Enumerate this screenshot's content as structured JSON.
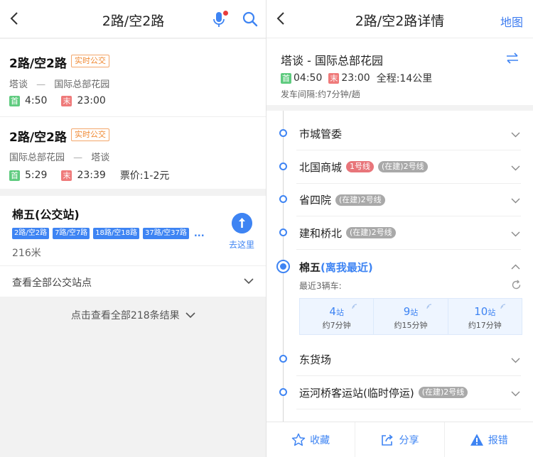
{
  "left": {
    "header": {
      "title": "2路/空2路"
    },
    "results": [
      {
        "name": "2路/空2路",
        "badge": "实时公交",
        "from": "塔谈",
        "dash": "—",
        "to": "国际总部花园",
        "first_tag": "首",
        "first_time": "4:50",
        "last_tag": "末",
        "last_time": "23:00",
        "fare": ""
      },
      {
        "name": "2路/空2路",
        "badge": "实时公交",
        "from": "国际总部花园",
        "dash": "—",
        "to": "塔谈",
        "first_tag": "首",
        "first_time": "5:29",
        "last_tag": "末",
        "last_time": "23:39",
        "fare": "票价:1-2元"
      }
    ],
    "station": {
      "name": "棉五(公交站)",
      "lines": [
        "2路/空2路",
        "7路/空7路",
        "18路/空18路",
        "37路/空37路"
      ],
      "more": "...",
      "distance": "216米",
      "go_label": "去这里",
      "view_all": "查看全部公交站点"
    },
    "more_results": "点击查看全部218条结果"
  },
  "right": {
    "header": {
      "title": "2路/空2路详情",
      "map": "地图"
    },
    "route": "塔谈 - 国际总部花园",
    "first_tag": "首",
    "first_time": "04:50",
    "last_tag": "末",
    "last_time": "23:00",
    "length": "全程:14公里",
    "interval": "发车间隔:约7分钟/趟",
    "stations_top": [
      {
        "name": "市城管委",
        "tags": []
      },
      {
        "name": "北国商城",
        "tags": [
          {
            "text": "1号线",
            "color": "red"
          },
          {
            "text": "(在建)2号线",
            "color": "gray"
          }
        ]
      },
      {
        "name": "省四院",
        "tags": [
          {
            "text": "(在建)2号线",
            "color": "gray"
          }
        ]
      },
      {
        "name": "建和桥北",
        "tags": [
          {
            "text": "(在建)2号线",
            "color": "gray"
          }
        ]
      }
    ],
    "current": {
      "name": "棉五",
      "near": "(离我最近)",
      "recent_label": "最近3辆车:",
      "arrivals": [
        {
          "stops": "4",
          "unit": "站",
          "eta": "约7分钟"
        },
        {
          "stops": "9",
          "unit": "站",
          "eta": "约15分钟"
        },
        {
          "stops": "10",
          "unit": "站",
          "eta": "约17分钟"
        }
      ]
    },
    "stations_bottom": [
      {
        "name": "东货场",
        "tags": []
      },
      {
        "name": "运河桥客运站(临时停运)",
        "tags": [
          {
            "text": "(在建)2号线",
            "color": "gray"
          }
        ]
      }
    ],
    "bottom": {
      "favorite": "收藏",
      "share": "分享",
      "report": "报错"
    }
  },
  "colors": {
    "accent": "#3e84f3",
    "first": "#5fcb7f",
    "last": "#ef7a7a",
    "badge": "#f08a34"
  }
}
